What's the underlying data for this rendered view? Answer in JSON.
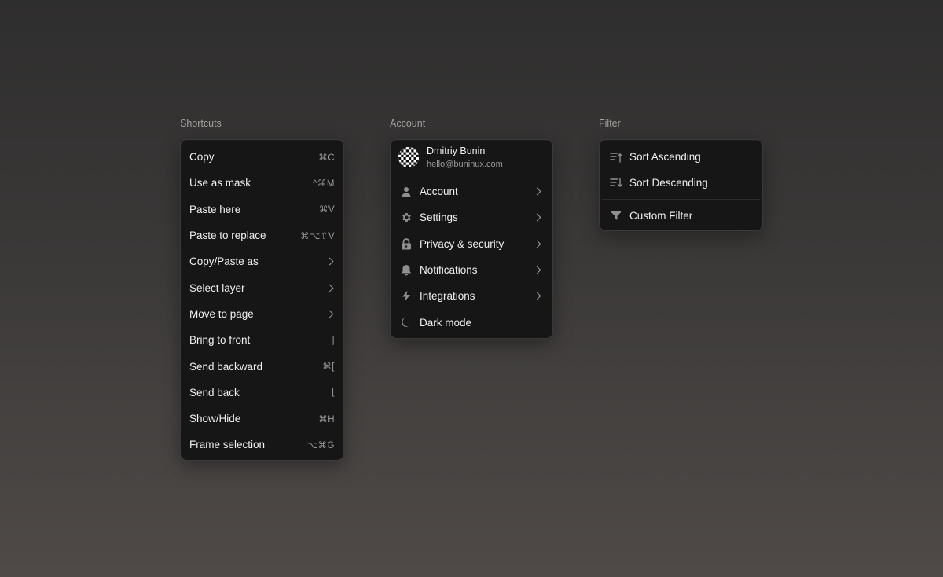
{
  "sections": {
    "shortcuts_label": "Shortcuts",
    "account_label": "Account",
    "filter_label": "Filter"
  },
  "shortcuts": {
    "items": [
      {
        "label": "Copy",
        "shortcut": "⌘C"
      },
      {
        "label": "Use as mask",
        "shortcut": "^⌘M"
      },
      {
        "label": "Paste here",
        "shortcut": "⌘V"
      },
      {
        "label": "Paste to replace",
        "shortcut": "⌘⌥⇧V"
      },
      {
        "label": "Copy/Paste as",
        "submenu": true
      },
      {
        "label": "Select layer",
        "submenu": true
      },
      {
        "label": "Move to page",
        "submenu": true
      },
      {
        "label": "Bring to front",
        "shortcut": "]"
      },
      {
        "label": "Send backward",
        "shortcut": "⌘["
      },
      {
        "label": "Send back",
        "shortcut": "["
      },
      {
        "label": "Show/Hide",
        "shortcut": "⌘H"
      },
      {
        "label": "Frame selection",
        "shortcut": "⌥⌘G"
      }
    ]
  },
  "account": {
    "user": {
      "name": "Dmitriy Bunin",
      "email": "hello@buninux.com",
      "avatar_icon": "checkered-avatar"
    },
    "items": [
      {
        "label": "Account",
        "icon": "user-icon",
        "submenu": true
      },
      {
        "label": "Settings",
        "icon": "gear-icon",
        "submenu": true
      },
      {
        "label": "Privacy & security",
        "icon": "lock-icon",
        "submenu": true
      },
      {
        "label": "Notifications",
        "icon": "bell-icon",
        "submenu": true
      },
      {
        "label": "Integrations",
        "icon": "bolt-icon",
        "submenu": true
      },
      {
        "label": "Dark mode",
        "icon": "moon-icon",
        "submenu": false
      }
    ]
  },
  "filter": {
    "items": [
      {
        "label": "Sort Ascending",
        "icon": "sort-ascending-icon"
      },
      {
        "label": "Sort Descending",
        "icon": "sort-descending-icon"
      },
      {
        "label": "Custom Filter",
        "icon": "filter-icon"
      }
    ]
  },
  "colors": {
    "menu_bg": "#161616",
    "menu_border": "#3a3a3a",
    "text": "#f0f0f0",
    "muted": "#9a9a9a",
    "icon": "#8f8f8f"
  }
}
